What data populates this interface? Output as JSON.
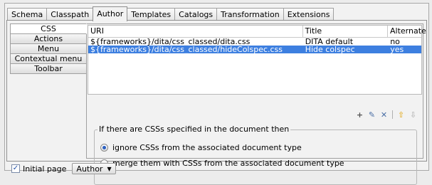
{
  "tabs": [
    "Schema",
    "Classpath",
    "Author",
    "Templates",
    "Catalogs",
    "Transformation",
    "Extensions"
  ],
  "selected_tab": "Author",
  "side_tabs": [
    "CSS",
    "Actions",
    "Menu",
    "Contextual menu",
    "Toolbar"
  ],
  "selected_side_tab": "CSS",
  "table": {
    "columns": [
      "URI",
      "Title",
      "Alternate"
    ],
    "rows": [
      {
        "uri": "${frameworks}/dita/css_classed/dita.css",
        "title": "DITA default",
        "alternate": "no",
        "selected": false
      },
      {
        "uri": "${frameworks}/dita/css_classed/hideColspec.css",
        "title": "Hide colspec",
        "alternate": "yes",
        "selected": true
      }
    ]
  },
  "toolbar_icons": [
    {
      "name": "add-icon",
      "glyph": "+",
      "color": "#555555"
    },
    {
      "name": "edit-icon",
      "glyph": "✎",
      "color": "#4a6fa5"
    },
    {
      "name": "delete-icon",
      "glyph": "✕",
      "color": "#4a6fa5"
    },
    {
      "name": "move-up-icon",
      "glyph": "⇧",
      "color": "#e0a000"
    },
    {
      "name": "move-down-icon",
      "glyph": "⇩",
      "color": "#aaaaaa"
    }
  ],
  "group": {
    "legend": "If there are CSSs specified in the document then",
    "options": [
      {
        "label": "ignore CSSs from the associated document type",
        "checked": true
      },
      {
        "label": "merge them with CSSs from the associated document type",
        "checked": false
      }
    ]
  },
  "bottom": {
    "checkbox_label": "Initial page",
    "checked": true,
    "select_value": "Author"
  },
  "colors": {
    "selection": "#3d7fe0"
  }
}
